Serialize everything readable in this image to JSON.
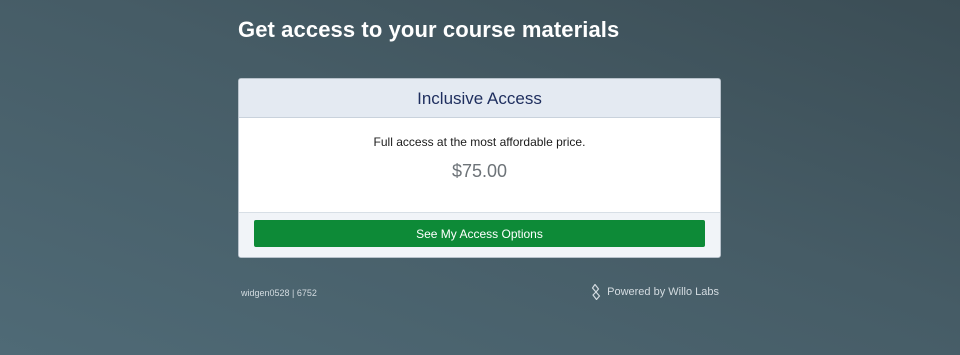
{
  "page": {
    "heading": "Get access to your course materials"
  },
  "card": {
    "title": "Inclusive Access",
    "description": "Full access at the most affordable price.",
    "price": "$75.00",
    "button_label": "See My Access Options"
  },
  "footer": {
    "id_text": "widgen0528 | 6752",
    "powered_by": "Powered by Willo Labs",
    "logo_icon": "willo-labs-logo-icon"
  },
  "colors": {
    "button": "#0d8a37",
    "card_header": "#e4eaf2",
    "title_text": "#1e2e5e"
  }
}
